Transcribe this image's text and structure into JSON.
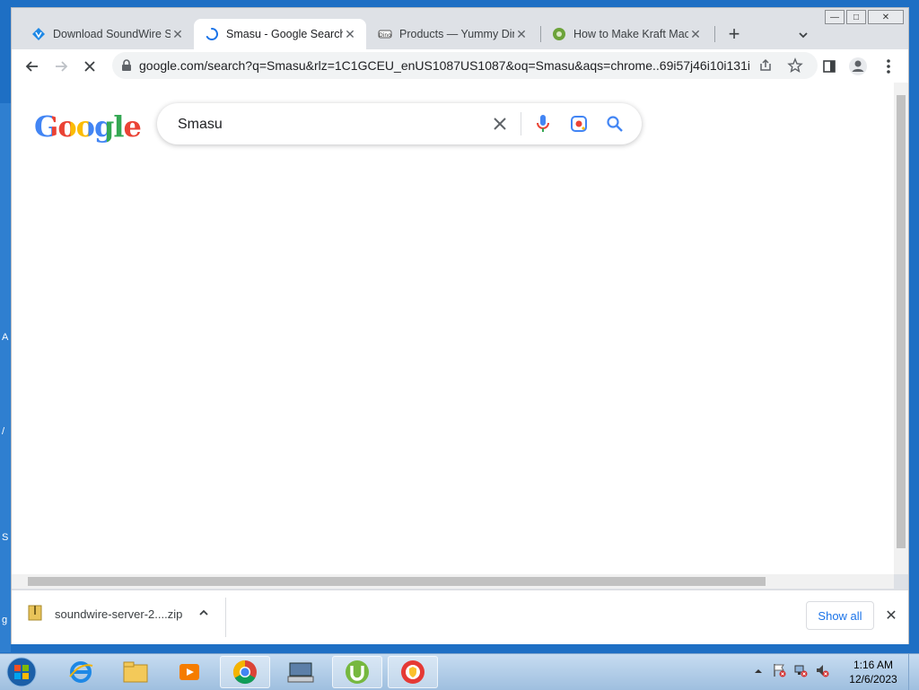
{
  "browser": {
    "tabs": [
      {
        "title": "Download SoundWire Se",
        "icon": "soundwire-icon",
        "active": false
      },
      {
        "title": "Smasu - Google Search",
        "icon": "loading-spinner-icon",
        "active": true
      },
      {
        "title": "Products — Yummy Din",
        "icon": "dino-icon",
        "active": false
      },
      {
        "title": "How to Make Kraft Mac",
        "icon": "recipe-site-icon",
        "active": false
      }
    ],
    "url": "google.com/search?q=Smasu&rlz=1C1GCEU_enUS1087US1087&oq=Smasu&aqs=chrome..69i57j46i10i131i...",
    "new_tab_symbol": "+",
    "window_controls": {
      "minimize": "—",
      "maximize": "□",
      "close": "✕"
    }
  },
  "page": {
    "logo_text": "Google",
    "search_value": "Smasu"
  },
  "download_bar": {
    "filename": "soundwire-server-2....zip",
    "show_all_label": "Show all"
  },
  "desktop": {
    "edge_letters": [
      "A",
      "/",
      "S",
      "g"
    ]
  },
  "taskbar": {
    "time": "1:16 AM",
    "date": "12/6/2023",
    "apps": [
      "ie-icon",
      "file-explorer-icon",
      "media-player-icon",
      "chrome-icon",
      "keyboard-app-icon",
      "utorrent-icon",
      "vpn-shield-icon"
    ]
  },
  "colors": {
    "accent": "#1a73e8",
    "tab_strip": "#dee1e6",
    "desktop": "#1e6fc4"
  }
}
